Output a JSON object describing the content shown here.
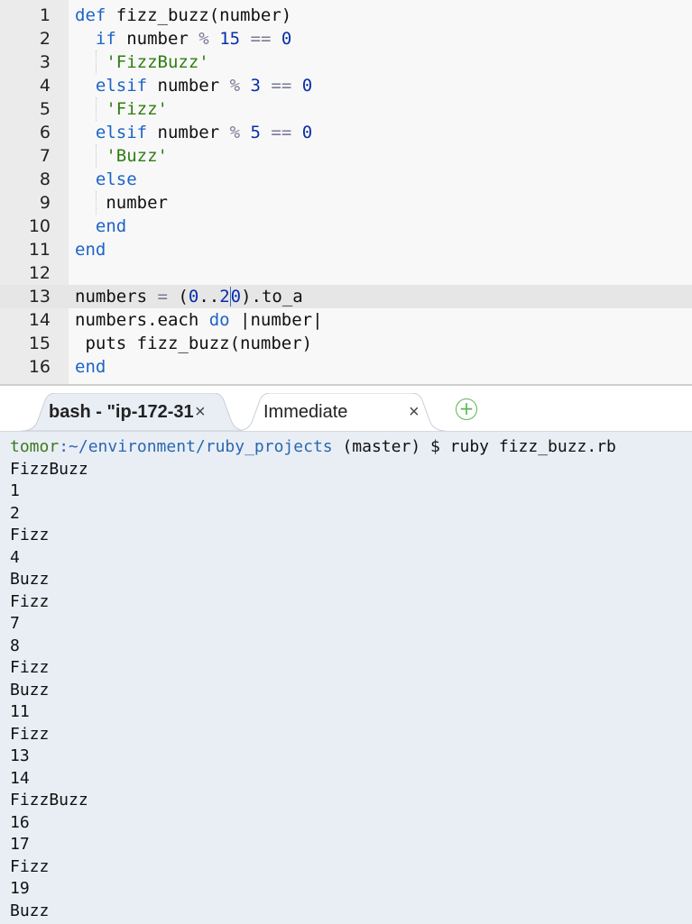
{
  "editor": {
    "lines": [
      {
        "n": "1",
        "indent": 0,
        "tokens": [
          {
            "t": "def",
            "c": "kw"
          },
          {
            "t": " fizz_buzz(number)",
            "c": ""
          }
        ]
      },
      {
        "n": "2",
        "indent": 2,
        "tokens": [
          {
            "t": "if",
            "c": "kw"
          },
          {
            "t": " number ",
            "c": ""
          },
          {
            "t": "%",
            "c": "op"
          },
          {
            "t": " ",
            "c": ""
          },
          {
            "t": "15",
            "c": "num"
          },
          {
            "t": " ",
            "c": ""
          },
          {
            "t": "==",
            "c": "op"
          },
          {
            "t": " ",
            "c": ""
          },
          {
            "t": "0",
            "c": "num"
          }
        ]
      },
      {
        "n": "3",
        "indent": 3,
        "tokens": [
          {
            "t": "'FizzBuzz'",
            "c": "str"
          }
        ]
      },
      {
        "n": "4",
        "indent": 2,
        "tokens": [
          {
            "t": "elsif",
            "c": "kw"
          },
          {
            "t": " number ",
            "c": ""
          },
          {
            "t": "%",
            "c": "op"
          },
          {
            "t": " ",
            "c": ""
          },
          {
            "t": "3",
            "c": "num"
          },
          {
            "t": " ",
            "c": ""
          },
          {
            "t": "==",
            "c": "op"
          },
          {
            "t": " ",
            "c": ""
          },
          {
            "t": "0",
            "c": "num"
          }
        ]
      },
      {
        "n": "5",
        "indent": 3,
        "tokens": [
          {
            "t": "'Fizz'",
            "c": "str"
          }
        ]
      },
      {
        "n": "6",
        "indent": 2,
        "tokens": [
          {
            "t": "elsif",
            "c": "kw"
          },
          {
            "t": " number ",
            "c": ""
          },
          {
            "t": "%",
            "c": "op"
          },
          {
            "t": " ",
            "c": ""
          },
          {
            "t": "5",
            "c": "num"
          },
          {
            "t": " ",
            "c": ""
          },
          {
            "t": "==",
            "c": "op"
          },
          {
            "t": " ",
            "c": ""
          },
          {
            "t": "0",
            "c": "num"
          }
        ]
      },
      {
        "n": "7",
        "indent": 3,
        "tokens": [
          {
            "t": "'Buzz'",
            "c": "str"
          }
        ]
      },
      {
        "n": "8",
        "indent": 2,
        "tokens": [
          {
            "t": "else",
            "c": "kw"
          }
        ]
      },
      {
        "n": "9",
        "indent": 3,
        "tokens": [
          {
            "t": "number",
            "c": ""
          }
        ]
      },
      {
        "n": "10",
        "indent": 2,
        "tokens": [
          {
            "t": "end",
            "c": "kw"
          }
        ]
      },
      {
        "n": "11",
        "indent": 0,
        "tokens": [
          {
            "t": "end",
            "c": "kw"
          }
        ]
      },
      {
        "n": "12",
        "indent": 0,
        "tokens": []
      },
      {
        "n": "13",
        "indent": 0,
        "active": true,
        "tokens": [
          {
            "t": "numbers ",
            "c": ""
          },
          {
            "t": "=",
            "c": "op"
          },
          {
            "t": " (",
            "c": ""
          },
          {
            "t": "0",
            "c": "num"
          },
          {
            "t": "..",
            "c": ""
          },
          {
            "t": "2",
            "c": "num"
          },
          {
            "t": "0",
            "c": "num cursor-char"
          },
          {
            "t": ").to_a",
            "c": ""
          }
        ]
      },
      {
        "n": "14",
        "indent": 0,
        "tokens": [
          {
            "t": "numbers.each ",
            "c": ""
          },
          {
            "t": "do",
            "c": "kw"
          },
          {
            "t": " |number|",
            "c": ""
          }
        ]
      },
      {
        "n": "15",
        "indent": 1,
        "tokens": [
          {
            "t": "puts fizz_buzz(number)",
            "c": ""
          }
        ]
      },
      {
        "n": "16",
        "indent": 0,
        "tokens": [
          {
            "t": "end",
            "c": "kw"
          }
        ]
      }
    ]
  },
  "tabs": [
    {
      "label": "bash - \"ip-172-31",
      "close": "×",
      "active": true
    },
    {
      "label": "Immediate",
      "close": "×",
      "active": false
    }
  ],
  "add_tab": "+",
  "terminal": {
    "prompt_user": "tomor",
    "prompt_path": ":~/environment/ruby_projects",
    "prompt_rest": " (master) $ ruby fizz_buzz.rb",
    "output": [
      "FizzBuzz",
      "1",
      "2",
      "Fizz",
      "4",
      "Buzz",
      "Fizz",
      "7",
      "8",
      "Fizz",
      "Buzz",
      "11",
      "Fizz",
      "13",
      "14",
      "FizzBuzz",
      "16",
      "17",
      "Fizz",
      "19",
      "Buzz"
    ]
  },
  "colors": {
    "keyword": "#1c64c8",
    "number": "#0a2ea8",
    "string": "#2f7d12",
    "prompt_user": "#3c7a1f",
    "prompt_path": "#2b67b0",
    "terminal_bg": "#e9eef5",
    "add_icon": "#5ab552"
  }
}
